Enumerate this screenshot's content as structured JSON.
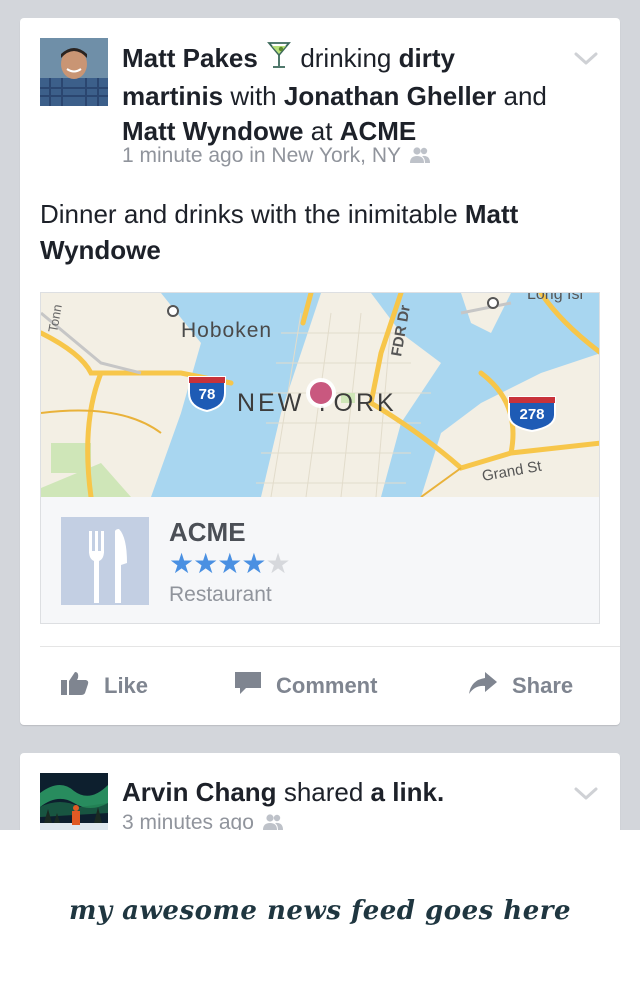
{
  "post1": {
    "author": "Matt Pakes",
    "activity_verb": "drinking",
    "activity_object": "dirty martinis",
    "with_word": "with",
    "friend_1": "Jonathan Gheller",
    "and_word": "and",
    "friend_2": "Matt Wyndowe",
    "at_word": "at",
    "place": "ACME",
    "timestamp": "1 minute ago in New York, NY",
    "body_text": "Dinner and drinks with the inimitable",
    "body_mention": "Matt Wyndowe",
    "icons": {
      "activity": "martini-icon",
      "audience": "friends-icon",
      "menu": "chevron-down-icon"
    }
  },
  "map": {
    "labels": {
      "hoboken": "Hoboken",
      "new_york": "NEW YORK",
      "fdr": "FDR Dr",
      "grand_st": "Grand St",
      "long_island": "Long Isl",
      "tonn": "Tonn",
      "shield_78": "78",
      "shield_278": "278"
    },
    "colors": {
      "water": "#a8d6f0",
      "land": "#f3efe4",
      "highway": "#f7c64a",
      "shield": "#1e5bb5",
      "pin": "#c9587f"
    }
  },
  "place_card": {
    "name": "ACME",
    "rating": 4,
    "rating_max": 5,
    "category": "Restaurant",
    "thumb_icon": "fork-knife-icon"
  },
  "actions": {
    "like": "Like",
    "comment": "Comment",
    "share": "Share"
  },
  "post2": {
    "author": "Arvin Chang",
    "verb": "shared",
    "object": "a link.",
    "timestamp": "3 minutes ago"
  },
  "tagline": "my awesome news feed goes here",
  "colors": {
    "feed_bg": "#d3d6db",
    "text": "#1d2129",
    "meta": "#90949c",
    "action": "#7f8590",
    "star": "#4a90e2"
  }
}
